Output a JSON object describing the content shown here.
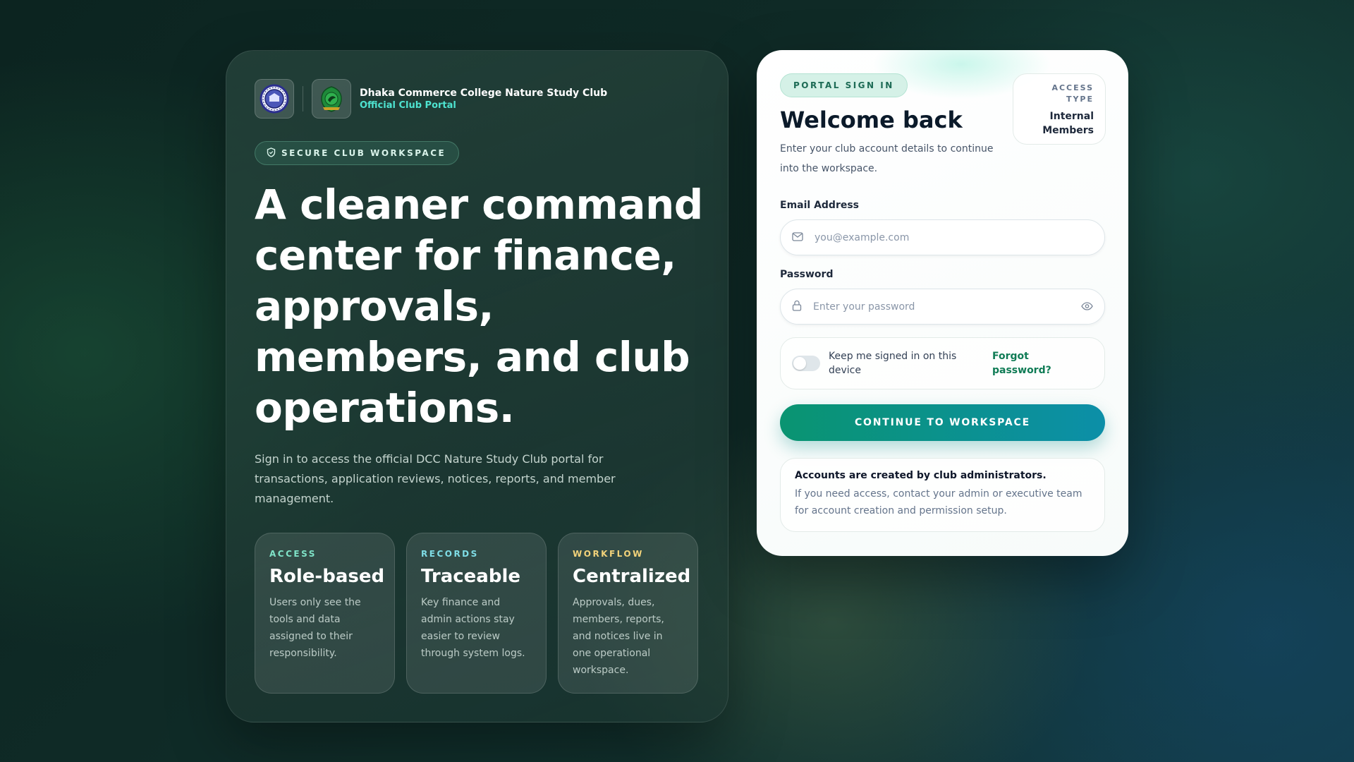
{
  "brand": {
    "name": "Dhaka Commerce College Nature Study Club",
    "subtitle": "Official Club Portal"
  },
  "hero": {
    "badge": "SECURE CLUB WORKSPACE",
    "headline": "A cleaner command center for finance, approvals, members, and club operations.",
    "intro": "Sign in to access the official DCC Nature Study Club portal for transactions, application reviews, notices, reports, and member management."
  },
  "features": [
    {
      "kicker": "ACCESS",
      "kicker_color": "#7fe3c8",
      "title": "Role-based",
      "body": "Users only see the tools and data assigned to their responsibility."
    },
    {
      "kicker": "RECORDS",
      "kicker_color": "#7fdde6",
      "title": "Traceable",
      "body": "Key finance and admin actions stay easier to review through system logs."
    },
    {
      "kicker": "WORKFLOW",
      "kicker_color": "#f1d27a",
      "title": "Centralized",
      "body": "Approvals, dues, members, reports, and notices live in one operational workspace."
    }
  ],
  "signin": {
    "badge": "PORTAL SIGN IN",
    "access_label": "ACCESS TYPE",
    "access_value": "Internal Members",
    "title": "Welcome back",
    "subtitle": "Enter your club account details to continue into the workspace.",
    "email_label": "Email Address",
    "email_placeholder": "you@example.com",
    "email_value": "",
    "password_label": "Password",
    "password_placeholder": "Enter your password",
    "password_value": "",
    "remember_label": "Keep me signed in on this device",
    "remember_checked": false,
    "forgot_label": "Forgot password?",
    "submit_label": "CONTINUE TO WORKSPACE",
    "notice_title": "Accounts are created by club administrators.",
    "notice_body": "If you need access, contact your admin or executive team for account creation and permission setup."
  },
  "colors": {
    "accent": "#0a9471",
    "accent_alt": "#0c8fa8",
    "brand_sub": "#4ee3d0",
    "link": "#0f7b55"
  },
  "icons": [
    "college-seal-icon",
    "club-emblem-icon",
    "shield-icon",
    "mail-icon",
    "lock-icon",
    "eye-icon"
  ]
}
